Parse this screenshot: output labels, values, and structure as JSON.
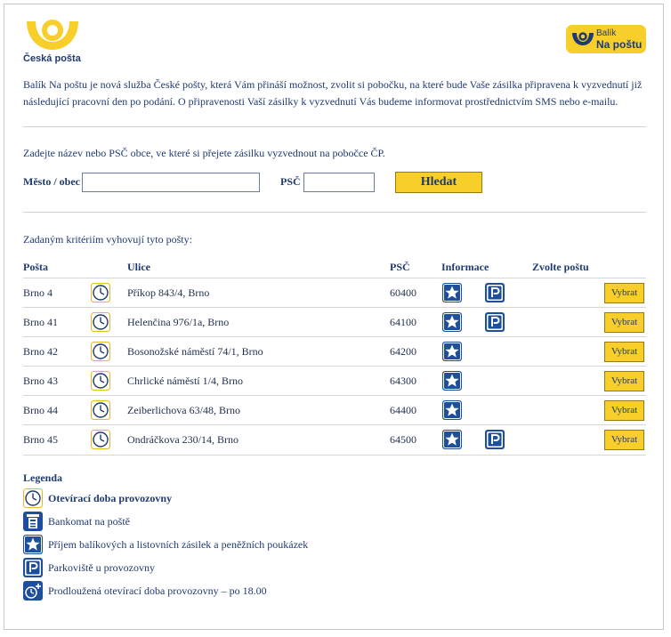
{
  "brand": {
    "logo_text": "Česká pošta",
    "badge_line1": "Balík",
    "badge_line2": "Na poštu"
  },
  "intro": "Balík Na poštu je nová služba České pošty, která Vám přináší možnost, zvolit si pobočku, na které bude Vaše zásilka připravena k vyzvednutí již následující pracovní den po podání. O připravenosti Vaší zásilky k vyzvednutí Vás budeme informovat prostřednictvím SMS nebo e-mailu.",
  "search": {
    "prompt": "Zadejte název nebo PSČ obce, ve které si přejete zásilku vyzvednout na pobočce ČP.",
    "city_label": "Město / obec",
    "city_value": "",
    "psc_label": "PSČ",
    "psc_value": "",
    "button": "Hledat"
  },
  "results": {
    "caption": "Zadaným kritériím vyhovují tyto pošty:",
    "headers": {
      "posta": "Pošta",
      "ulice": "Ulice",
      "psc": "PSČ",
      "informace": "Informace",
      "zvolte": "Zvolte poštu"
    },
    "select_label": "Vybrat",
    "rows": [
      {
        "posta": "Brno 4",
        "ulice": "Příkop 843/4, Brno",
        "psc": "60400",
        "parking": true
      },
      {
        "posta": "Brno 41",
        "ulice": "Helenčina 976/1a, Brno",
        "psc": "64100",
        "parking": true
      },
      {
        "posta": "Brno 42",
        "ulice": "Bosonožské náměstí 74/1, Brno",
        "psc": "64200",
        "parking": false
      },
      {
        "posta": "Brno 43",
        "ulice": "Chrlické náměstí 1/4, Brno",
        "psc": "64300",
        "parking": false
      },
      {
        "posta": "Brno 44",
        "ulice": "Zeiberlichova 63/48, Brno",
        "psc": "64400",
        "parking": false
      },
      {
        "posta": "Brno 45",
        "ulice": "Ondráčkova 230/14, Brno",
        "psc": "64500",
        "parking": true
      }
    ]
  },
  "legend": {
    "title": "Legenda",
    "items": [
      {
        "icon": "clock-icon",
        "label": "Otevírací doba provozovny"
      },
      {
        "icon": "atm-icon",
        "label": "Bankomat na poště"
      },
      {
        "icon": "star-icon",
        "label": "Příjem balíkových a listovních zásilek a peněžních poukázek"
      },
      {
        "icon": "parking-icon",
        "label": "Parkoviště u provozovny"
      },
      {
        "icon": "extended-hours-icon",
        "label": "Prodloužená otevírací doba provozovny – po 18.00"
      }
    ]
  },
  "colors": {
    "brand_yellow": "#f8cf2a",
    "brand_blue": "#1f3a70",
    "icon_blue": "#1d4f9c"
  }
}
